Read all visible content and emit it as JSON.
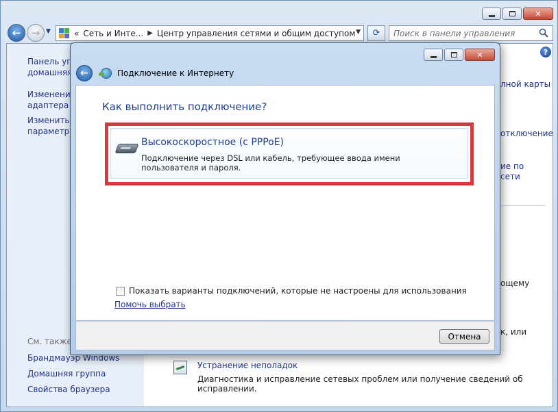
{
  "window": {
    "breadcrumb": [
      "Сеть и Инте...",
      "Центр управления сетями и общим доступом"
    ],
    "breadcrumb_prefix": "«",
    "search_placeholder": "Поиск в панели управления"
  },
  "sidebar": {
    "items": [
      {
        "line1": "Панель упр",
        "line2": "домашняя с"
      },
      {
        "line1": "Изменение",
        "line2": "адаптера"
      },
      {
        "line1": "Изменить д",
        "line2": "параметры"
      }
    ],
    "see_also_label": "См. также",
    "see_also": [
      "Брандмауэр Windows",
      "Домашняя группа",
      "Свойства браузера"
    ]
  },
  "main_fragments": {
    "full_map": "лной карты",
    "disconnect": "отключение",
    "by_network_1": "ие по",
    "by_network_2": "сети",
    "shared": "ощему",
    "or": "к, или"
  },
  "troubleshoot": {
    "title": "Устранение неполадок",
    "description": "Диагностика и исправление сетевых проблем или получение сведений об исправлении."
  },
  "dialog": {
    "title": "Подключение к Интернету",
    "heading": "Как выполнить подключение?",
    "option": {
      "title": "Высокоскоростное (с PPPoE)",
      "description": "Подключение через DSL или кабель, требующее ввода имени пользователя и пароля."
    },
    "show_all_label": "Показать варианты подключений, которые не настроены для использования",
    "show_all_checked": false,
    "help_link": "Помочь выбрать",
    "cancel_label": "Отмена",
    "highlight_color": "#d8383e"
  }
}
